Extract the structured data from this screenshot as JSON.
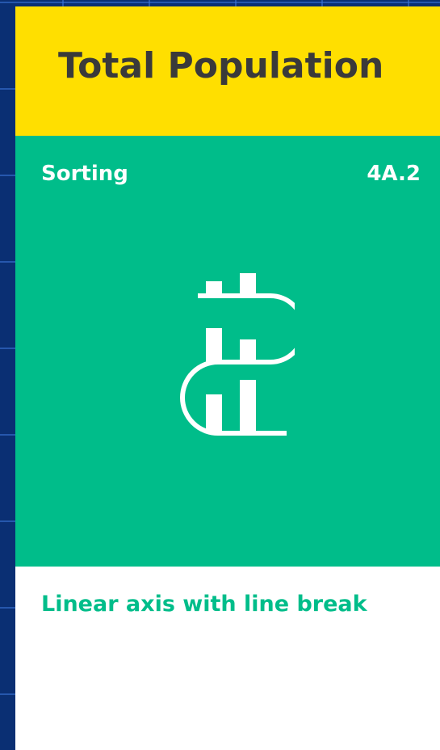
{
  "header": {
    "title": "Total Population"
  },
  "panel": {
    "category": "Sorting",
    "code": "4A.2",
    "icon": "broken-axis-bar-chart-icon"
  },
  "caption": "Linear axis with line break",
  "colors": {
    "background": "#0a2f73",
    "header": "#ffdf00",
    "title_text": "#3a3a3a",
    "panel": "#00bd8a",
    "card": "#ffffff",
    "caption": "#00bd8a"
  }
}
